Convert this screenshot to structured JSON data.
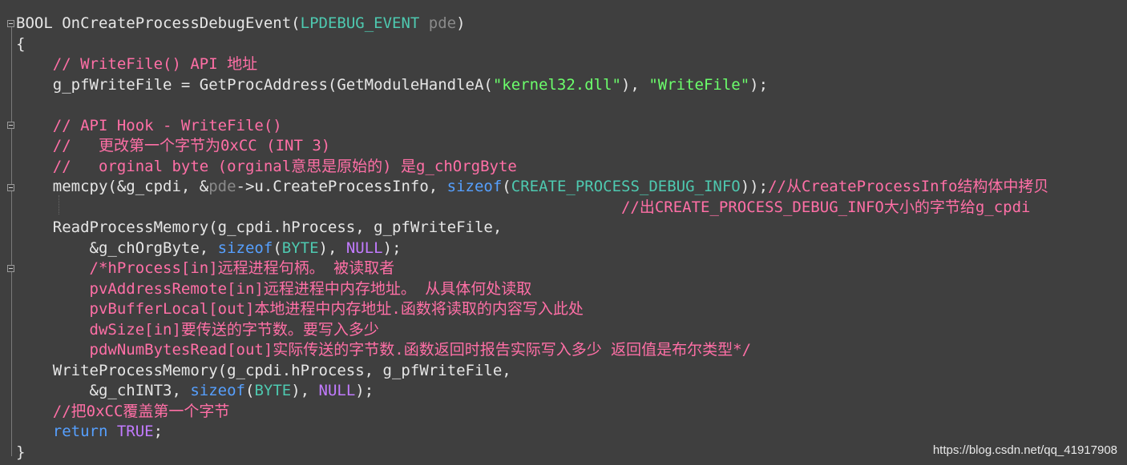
{
  "editor": {
    "lines": [
      {
        "segments": [
          {
            "t": "BOOL ",
            "c": "plain"
          },
          {
            "t": "OnCreateProcessDebugEvent(",
            "c": "plain"
          },
          {
            "t": "LPDEBUG_EVENT",
            "c": "type"
          },
          {
            "t": " ",
            "c": "plain"
          },
          {
            "t": "pde",
            "c": "param"
          },
          {
            "t": ")",
            "c": "plain"
          }
        ]
      },
      {
        "segments": [
          {
            "t": "{",
            "c": "plain"
          }
        ]
      },
      {
        "segments": [
          {
            "t": "    // WriteFile() API 地址",
            "c": "cm"
          }
        ]
      },
      {
        "segments": [
          {
            "t": "    g_pfWriteFile = GetProcAddress(GetModuleHandleA(",
            "c": "plain"
          },
          {
            "t": "\"kernel32.dll\"",
            "c": "str"
          },
          {
            "t": "), ",
            "c": "plain"
          },
          {
            "t": "\"WriteFile\"",
            "c": "str"
          },
          {
            "t": ");",
            "c": "plain"
          }
        ]
      },
      {
        "segments": [
          {
            "t": "",
            "c": "plain"
          }
        ]
      },
      {
        "segments": [
          {
            "t": "    // API Hook - WriteFile()",
            "c": "cm"
          }
        ]
      },
      {
        "segments": [
          {
            "t": "    //   更改第一个字节为0xCC (INT 3)",
            "c": "cm"
          }
        ]
      },
      {
        "segments": [
          {
            "t": "    //   orginal byte (orginal意思是原始的) 是g_chOrgByte",
            "c": "cm"
          }
        ]
      },
      {
        "segments": [
          {
            "t": "    memcpy(&g_cpdi, &",
            "c": "plain"
          },
          {
            "t": "pde",
            "c": "param"
          },
          {
            "t": "->u.CreateProcessInfo, ",
            "c": "plain"
          },
          {
            "t": "sizeof",
            "c": "kw-blue"
          },
          {
            "t": "(",
            "c": "plain"
          },
          {
            "t": "CREATE_PROCESS_DEBUG_INFO",
            "c": "type"
          },
          {
            "t": "));",
            "c": "plain"
          },
          {
            "t": "//从CreateProcessInfo结构体中拷贝",
            "c": "cm"
          }
        ]
      },
      {
        "segments": [
          {
            "t": "                                                                  //出CREATE_PROCESS_DEBUG_INFO大小的字节给g_cpdi",
            "c": "cm"
          }
        ]
      },
      {
        "segments": [
          {
            "t": "    ReadProcessMemory(g_cpdi.hProcess, g_pfWriteFile,",
            "c": "plain"
          }
        ]
      },
      {
        "segments": [
          {
            "t": "        &g_chOrgByte, ",
            "c": "plain"
          },
          {
            "t": "sizeof",
            "c": "kw-blue"
          },
          {
            "t": "(",
            "c": "plain"
          },
          {
            "t": "BYTE",
            "c": "type"
          },
          {
            "t": "), ",
            "c": "plain"
          },
          {
            "t": "NULL",
            "c": "null"
          },
          {
            "t": ");",
            "c": "plain"
          }
        ]
      },
      {
        "segments": [
          {
            "t": "        /*hProcess[in]远程进程句柄。 被读取者",
            "c": "cm"
          }
        ]
      },
      {
        "segments": [
          {
            "t": "        pvAddressRemote[in]远程进程中内存地址。 从具体何处读取",
            "c": "cm"
          }
        ]
      },
      {
        "segments": [
          {
            "t": "        pvBufferLocal[out]本地进程中内存地址.函数将读取的内容写入此处",
            "c": "cm"
          }
        ]
      },
      {
        "segments": [
          {
            "t": "        dwSize[in]要传送的字节数。要写入多少",
            "c": "cm"
          }
        ]
      },
      {
        "segments": [
          {
            "t": "        pdwNumBytesRead[out]实际传送的字节数.函数返回时报告实际写入多少 返回值是布尔类型*/",
            "c": "cm"
          }
        ]
      },
      {
        "segments": [
          {
            "t": "    WriteProcessMemory(g_cpdi.hProcess, g_pfWriteFile,",
            "c": "plain"
          }
        ]
      },
      {
        "segments": [
          {
            "t": "        &g_chINT3, ",
            "c": "plain"
          },
          {
            "t": "sizeof",
            "c": "kw-blue"
          },
          {
            "t": "(",
            "c": "plain"
          },
          {
            "t": "BYTE",
            "c": "type"
          },
          {
            "t": "), ",
            "c": "plain"
          },
          {
            "t": "NULL",
            "c": "null"
          },
          {
            "t": ");",
            "c": "plain"
          }
        ]
      },
      {
        "segments": [
          {
            "t": "    //把0xCC覆盖第一个字节",
            "c": "cm"
          }
        ]
      },
      {
        "segments": [
          {
            "t": "    ",
            "c": "plain"
          },
          {
            "t": "return",
            "c": "kw-blue"
          },
          {
            "t": " ",
            "c": "plain"
          },
          {
            "t": "TRUE",
            "c": "true"
          },
          {
            "t": ";",
            "c": "plain"
          }
        ]
      },
      {
        "segments": [
          {
            "t": "}",
            "c": "plain"
          }
        ]
      }
    ]
  },
  "watermark": {
    "text": "https://blog.csdn.net/qq_41917908"
  },
  "colors": {
    "background": "#3f3f3f",
    "comment": "#ff6fa6",
    "string": "#6cff6c",
    "type": "#4ec9b0",
    "keyword": "#56a0ff"
  }
}
